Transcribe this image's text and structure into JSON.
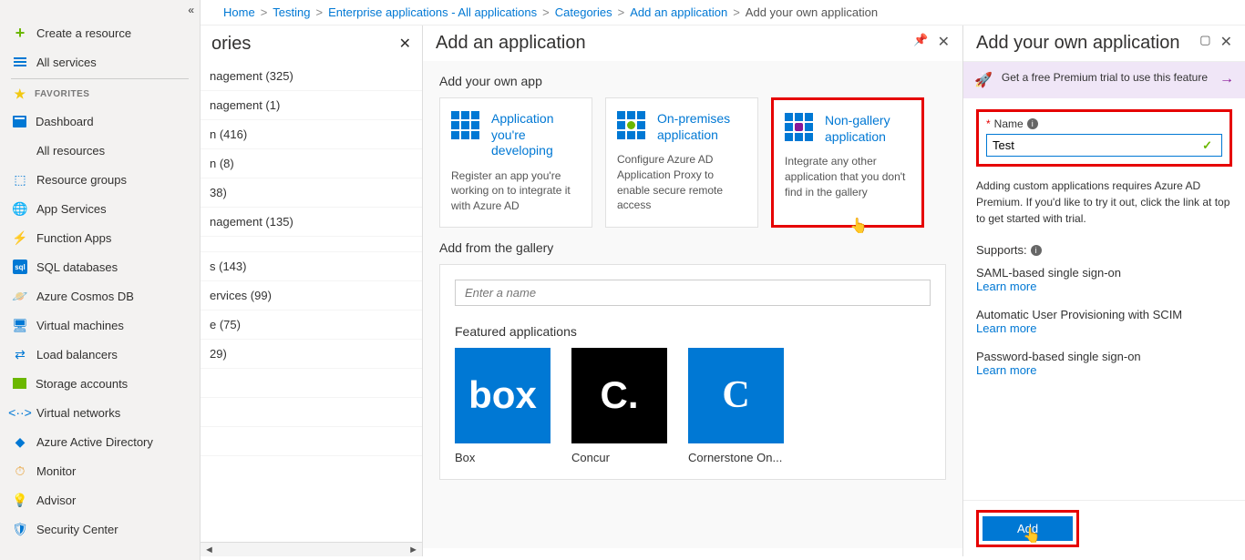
{
  "breadcrumb": {
    "items": [
      "Home",
      "Testing",
      "Enterprise applications - All applications",
      "Categories",
      "Add an application"
    ],
    "current": "Add your own application"
  },
  "sidebar": {
    "create": "Create a resource",
    "all_services": "All services",
    "favorites": "FAVORITES",
    "items": [
      "Dashboard",
      "All resources",
      "Resource groups",
      "App Services",
      "Function Apps",
      "SQL databases",
      "Azure Cosmos DB",
      "Virtual machines",
      "Load balancers",
      "Storage accounts",
      "Virtual networks",
      "Azure Active Directory",
      "Monitor",
      "Advisor",
      "Security Center"
    ]
  },
  "categories": {
    "title": "ories",
    "rows": [
      "nagement (325)",
      "nagement (1)",
      "n (416)",
      "n (8)",
      "38)",
      "nagement (135)",
      "",
      "s (143)",
      "ervices (99)",
      "e (75)",
      "29)",
      "",
      "",
      ""
    ]
  },
  "addapp": {
    "title": "Add an application",
    "own_title": "Add your own app",
    "tiles": {
      "dev": {
        "title": "Application you're developing",
        "desc": "Register an app you're working on to integrate it with Azure AD"
      },
      "onprem": {
        "title": "On-premises application",
        "desc": "Configure Azure AD Application Proxy to enable secure remote access"
      },
      "nongallery": {
        "title": "Non-gallery application",
        "desc": "Integrate any other application that you don't find in the gallery"
      }
    },
    "gallery_title": "Add from the gallery",
    "search_placeholder": "Enter a name",
    "featured_title": "Featured applications",
    "featured": [
      {
        "label": "Box",
        "art": "box"
      },
      {
        "label": "Concur",
        "art": "C."
      },
      {
        "label": "Cornerstone On...",
        "art": "C"
      }
    ]
  },
  "ownapp": {
    "title": "Add your own application",
    "promo": "Get a free Premium trial to use this feature",
    "name_label": "Name",
    "name_value": "Test",
    "help": "Adding custom applications requires Azure AD Premium. If you'd like to try it out, click the link at top to get started with trial.",
    "supports_label": "Supports:",
    "supports": [
      {
        "title": "SAML-based single sign-on",
        "link": "Learn more"
      },
      {
        "title": "Automatic User Provisioning with SCIM",
        "link": "Learn more"
      },
      {
        "title": "Password-based single sign-on",
        "link": "Learn more"
      }
    ],
    "add_btn": "Add"
  }
}
